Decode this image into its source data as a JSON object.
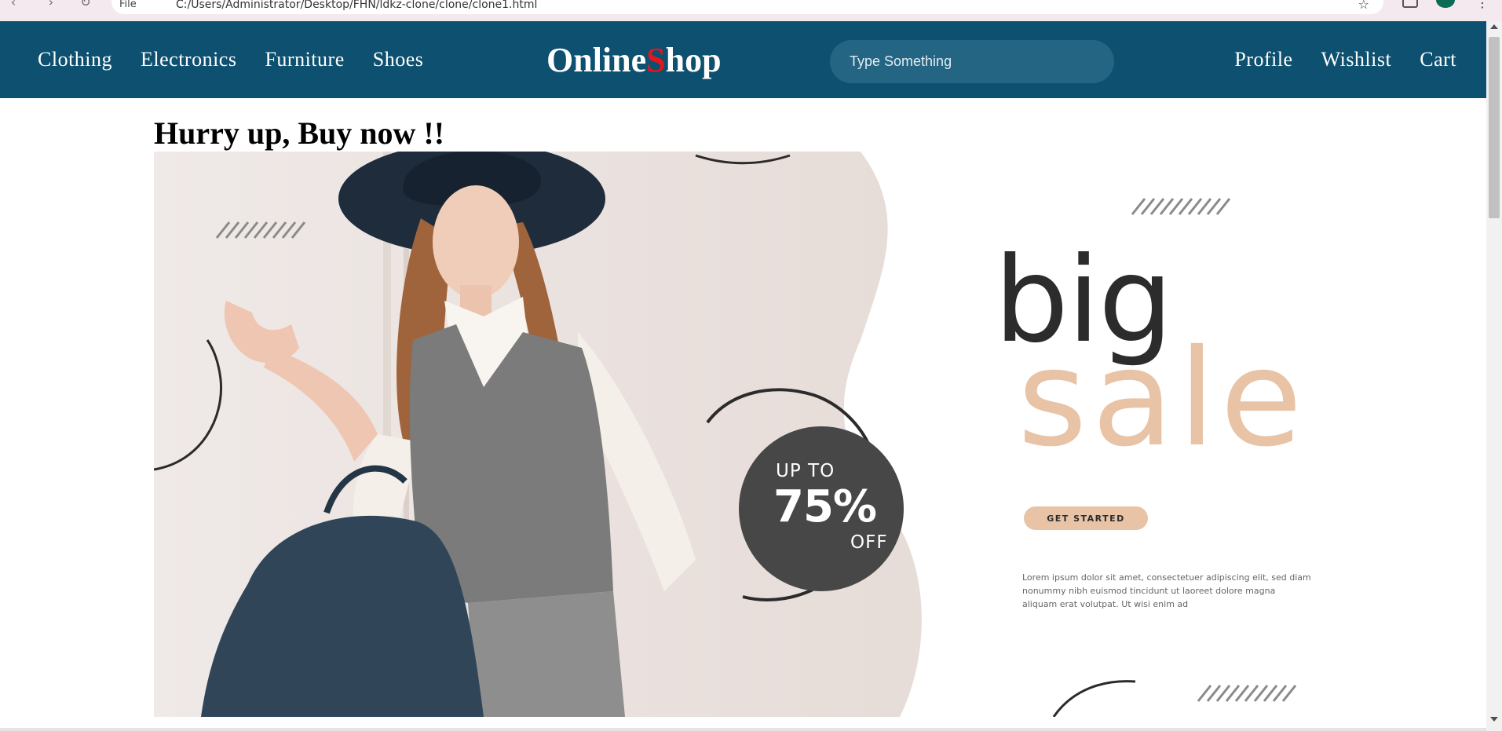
{
  "browser": {
    "file_chip": "File",
    "url": "C:/Users/Administrator/Desktop/FHN/ldkz-clone/clone/clone1.html"
  },
  "nav": {
    "left_links": [
      "Clothing",
      "Electronics",
      "Furniture",
      "Shoes"
    ],
    "logo_part1": "Online ",
    "logo_accent": "S",
    "logo_part2": "hop",
    "search_placeholder": "Type Something",
    "right_links": [
      "Profile",
      "Wishlist",
      "Cart"
    ]
  },
  "main": {
    "heading": "Hurry up, Buy now !!"
  },
  "banner": {
    "big": "big",
    "sale": "sale",
    "badge_up": "UP TO",
    "badge_percent": "75%",
    "badge_off": "OFF",
    "cta": "GET STARTED",
    "lorem": "Lorem ipsum dolor sit amet, consectetuer adipiscing elit, sed diam nonummy nibh euismod tincidunt ut laoreet dolore magna aliquam erat volutpat. Ut wisi enim ad"
  },
  "colors": {
    "navbar": "#0d506f",
    "search_bg": "#236582",
    "logo_accent": "#e8141d",
    "sale_peach": "#e8c3a6"
  }
}
